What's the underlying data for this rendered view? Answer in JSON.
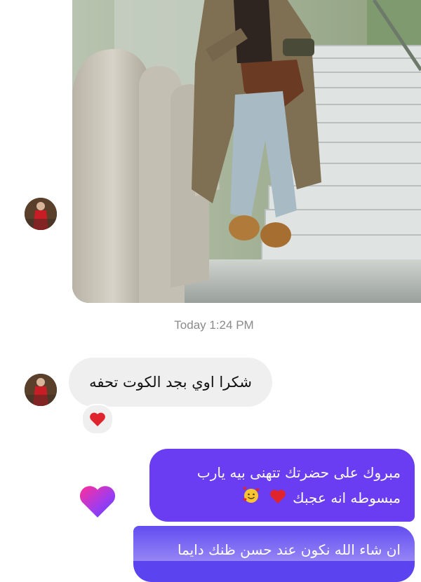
{
  "conversation": {
    "timestamp": "Today 1:24 PM",
    "incoming": {
      "text": "شكرا اوي بجد الكوت تحفه",
      "reaction": "heart"
    },
    "outgoing": [
      {
        "line1": "مبروك على حضرتك تتهنى بيه يارب",
        "line2": "مبسوطه انه عجبك"
      },
      {
        "line1": "ان شاء الله نكون عند حسن ظنك دايما"
      }
    ],
    "sent_reaction": "gradient-heart"
  },
  "colors": {
    "outgoing_bubble": "#6b3df2",
    "incoming_bubble": "#efefef",
    "timestamp_text": "#8a8a8a",
    "heart_red": "#e0242e"
  }
}
